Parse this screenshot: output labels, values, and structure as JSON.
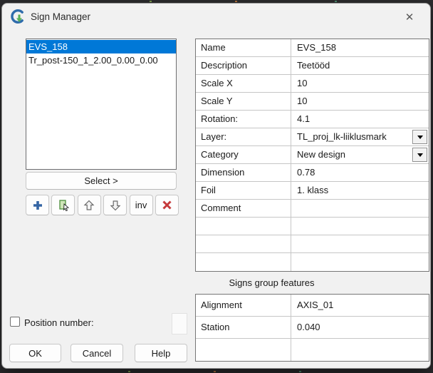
{
  "window": {
    "title": "Sign Manager",
    "close_glyph": "✕"
  },
  "sign_list": {
    "items": [
      {
        "label": "EVS_158",
        "selected": true
      },
      {
        "label": "Tr_post-150_1_2.00_0.00_0.00",
        "selected": false
      }
    ]
  },
  "actions": {
    "select_button": "Select >",
    "toolbar": [
      {
        "name": "add-sign",
        "icon": "plus-icon"
      },
      {
        "name": "pick-sign",
        "icon": "pick-cursor-icon"
      },
      {
        "name": "move-up",
        "icon": "arrow-up-icon"
      },
      {
        "name": "move-down",
        "icon": "arrow-down-icon"
      },
      {
        "name": "invert-selection",
        "label": "inv"
      },
      {
        "name": "delete-sign",
        "icon": "delete-x-icon"
      }
    ]
  },
  "properties": {
    "rows": [
      {
        "label": "Name",
        "value": "EVS_158"
      },
      {
        "label": "Description",
        "value": "Teetööd"
      },
      {
        "label": "Scale X",
        "value": "10"
      },
      {
        "label": "Scale Y",
        "value": "10"
      },
      {
        "label": "Rotation:",
        "value": "4.1"
      },
      {
        "label": "Layer:",
        "value": "TL_proj_lk-liiklusmark",
        "dropdown": true
      },
      {
        "label": "Category",
        "value": "New design",
        "dropdown": true
      },
      {
        "label": "Dimension",
        "value": "0.78"
      },
      {
        "label": "Foil",
        "value": "1. klass"
      },
      {
        "label": "Comment",
        "value": ""
      },
      {
        "label": "",
        "value": ""
      },
      {
        "label": "",
        "value": ""
      },
      {
        "label": "",
        "value": ""
      }
    ]
  },
  "signs_group": {
    "title": "Signs group features",
    "rows": [
      {
        "label": "Alignment",
        "value": "AXIS_01"
      },
      {
        "label": "Station",
        "value": "0.040"
      },
      {
        "label": "",
        "value": ""
      }
    ]
  },
  "footer": {
    "position_number_label": "Position number:",
    "position_number_checked": false,
    "ok": "OK",
    "cancel": "Cancel",
    "help": "Help"
  },
  "colors": {
    "selection": "#0078d7",
    "dialog_bg": "#f1f1f1",
    "logo_blue": "#2e6cab",
    "logo_green": "#55b054",
    "delete_red": "#c5393b"
  }
}
